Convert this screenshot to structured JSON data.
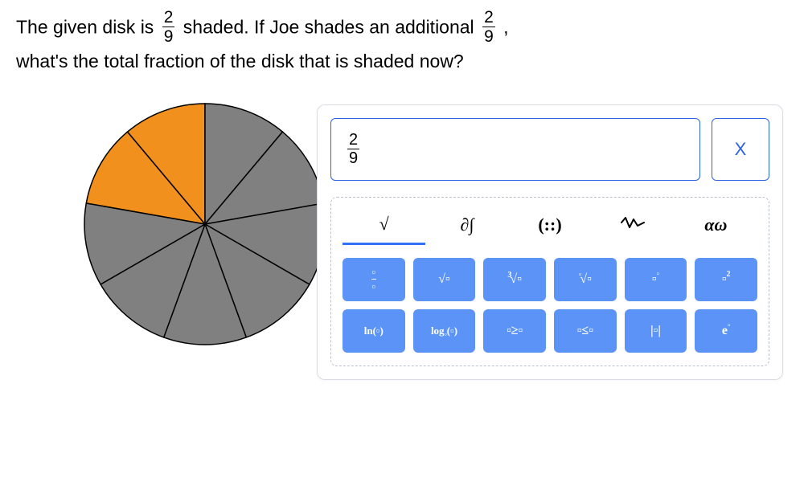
{
  "question": {
    "part1": "The given disk is",
    "frac1": {
      "num": "2",
      "den": "9"
    },
    "part2": "shaded. If Joe shades an additional",
    "frac2": {
      "num": "2",
      "den": "9"
    },
    "part3": ",",
    "part4": "what's the total fraction of the disk that is shaded now?"
  },
  "disk": {
    "total_slices": 9,
    "shaded_slices": 2,
    "shaded_color": "#f2901d",
    "unshaded_color": "#808080",
    "stroke": "#000000"
  },
  "answer": {
    "num": "2",
    "den": "9"
  },
  "clear_label": "X",
  "tabs": [
    {
      "id": "root",
      "label": "√",
      "active": true
    },
    {
      "id": "calculus",
      "label": "∂∫",
      "active": false
    },
    {
      "id": "matrix",
      "label": "(::)",
      "active": false
    },
    {
      "id": "stats",
      "label": "∿",
      "active": false
    },
    {
      "id": "greek",
      "label": "αω",
      "active": false
    }
  ],
  "keys_row1": [
    {
      "id": "fraction",
      "type": "frac",
      "top": "▫",
      "bot": "▫"
    },
    {
      "id": "sqrt",
      "type": "text",
      "label": "√▫"
    },
    {
      "id": "cbrt",
      "type": "root",
      "idx": "3",
      "label": "√▫"
    },
    {
      "id": "nroot",
      "type": "root",
      "idx": "▫",
      "label": "√▫"
    },
    {
      "id": "power",
      "type": "sup",
      "base": "▫",
      "sup": "▫"
    },
    {
      "id": "square",
      "type": "sup",
      "base": "▫",
      "sup": "2"
    }
  ],
  "keys_row2": [
    {
      "id": "ln",
      "type": "text",
      "label": "ln(▫)"
    },
    {
      "id": "log",
      "type": "logsub",
      "label": "log",
      "sub": "▫",
      "after": "(▫)"
    },
    {
      "id": "gte",
      "type": "text",
      "label": "▫≥▫"
    },
    {
      "id": "lte",
      "type": "text",
      "label": "▫≤▫"
    },
    {
      "id": "abs",
      "type": "text",
      "label": "|▫|"
    },
    {
      "id": "exp",
      "type": "sup",
      "base": "e",
      "sup": "▫"
    }
  ]
}
